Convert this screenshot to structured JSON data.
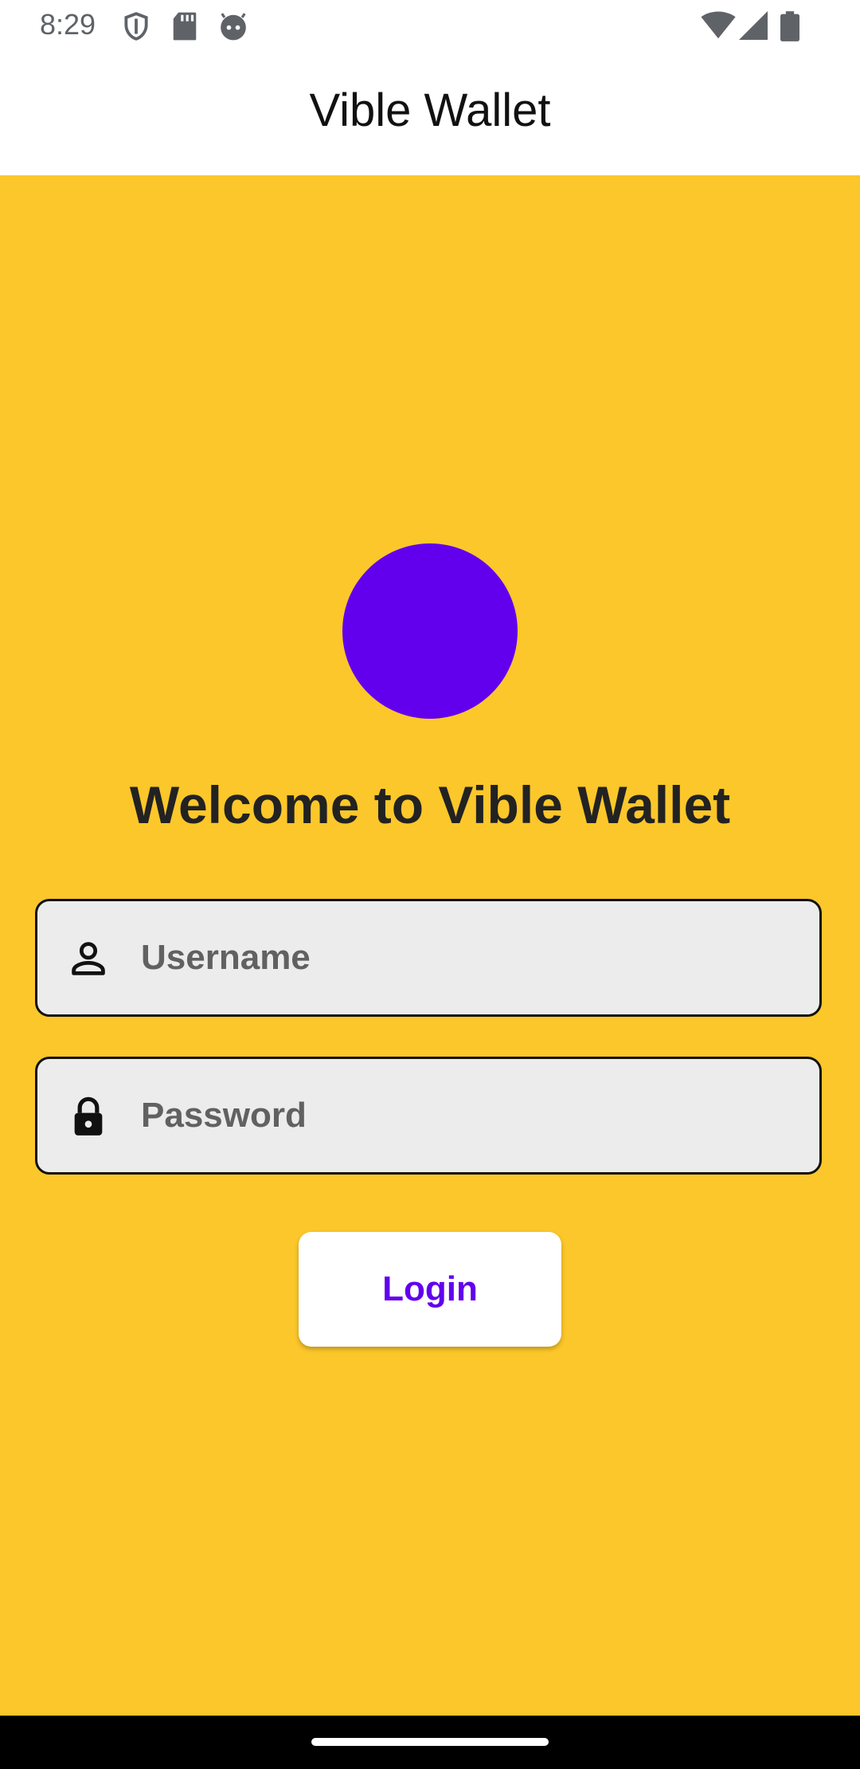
{
  "status_bar": {
    "time": "8:29",
    "left_icons": [
      "shield-icon",
      "sd-card-icon",
      "android-face-icon"
    ],
    "right_icons": [
      "wifi-icon",
      "signal-icon",
      "battery-icon"
    ]
  },
  "app_bar": {
    "title": "Vible Wallet"
  },
  "login": {
    "welcome": "Welcome to Vible Wallet",
    "username_placeholder": "Username",
    "password_placeholder": "Password",
    "login_label": "Login",
    "username_icon": "person-icon",
    "password_icon": "lock-icon"
  },
  "colors": {
    "background": "#fcc72a",
    "accent": "#6200ee",
    "field_fill": "#ececec"
  }
}
